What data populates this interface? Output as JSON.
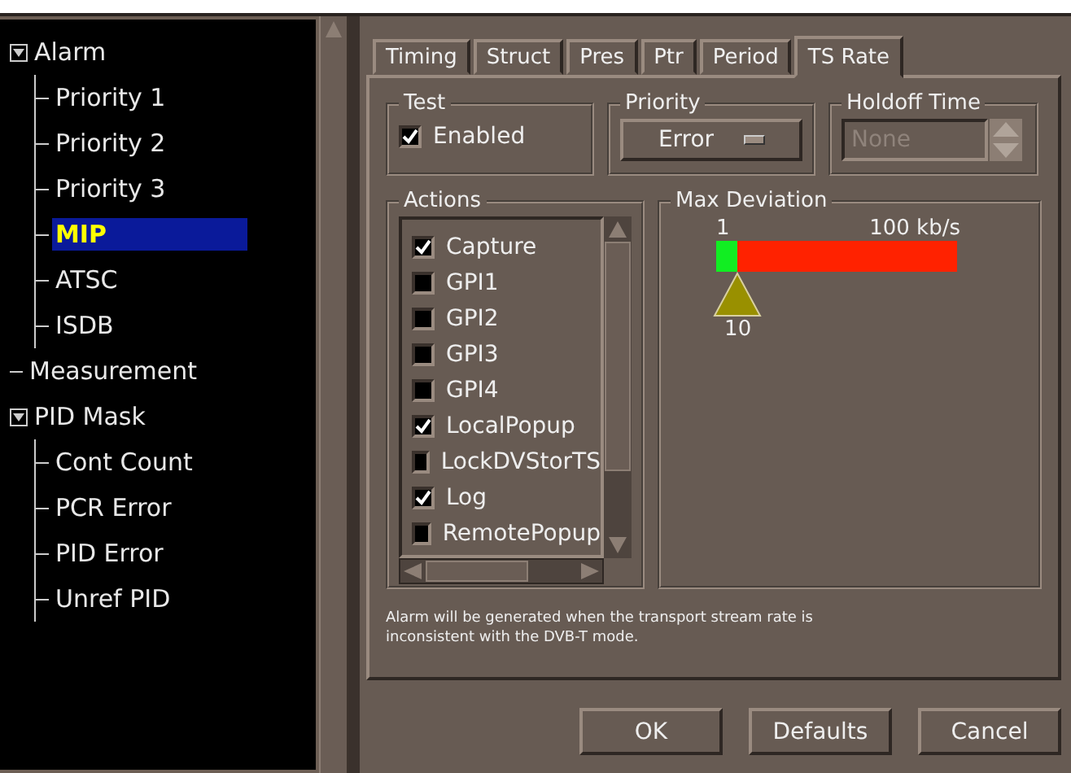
{
  "tree": [
    {
      "label": "Alarm",
      "expanded": true,
      "selected": false,
      "children": [
        {
          "label": "Priority 1",
          "selected": false
        },
        {
          "label": "Priority 2",
          "selected": false
        },
        {
          "label": "Priority 3",
          "selected": false
        },
        {
          "label": "MIP",
          "selected": true
        },
        {
          "label": "ATSC",
          "selected": false
        },
        {
          "label": "ISDB",
          "selected": false
        }
      ]
    },
    {
      "label": "Measurement",
      "selected": false
    },
    {
      "label": "PID Mask",
      "expanded": true,
      "selected": false,
      "children": [
        {
          "label": "Cont Count",
          "selected": false
        },
        {
          "label": "PCR Error",
          "selected": false
        },
        {
          "label": "PID Error",
          "selected": false
        },
        {
          "label": "Unref PID",
          "selected": false
        }
      ]
    }
  ],
  "tabs": [
    {
      "label": "Timing",
      "selected": false
    },
    {
      "label": "Struct",
      "selected": false
    },
    {
      "label": "Pres",
      "selected": false
    },
    {
      "label": "Ptr",
      "selected": false
    },
    {
      "label": "Period",
      "selected": false
    },
    {
      "label": "TS Rate",
      "selected": true
    }
  ],
  "test": {
    "title": "Test",
    "label": "Enabled",
    "checked": true
  },
  "priority": {
    "title": "Priority",
    "value": "Error"
  },
  "holdoff": {
    "title": "Holdoff Time",
    "value": "None",
    "disabled": true
  },
  "actions": {
    "title": "Actions",
    "items": [
      {
        "label": "Capture",
        "checked": true
      },
      {
        "label": "GPI1",
        "checked": false
      },
      {
        "label": "GPI2",
        "checked": false
      },
      {
        "label": "GPI3",
        "checked": false
      },
      {
        "label": "GPI4",
        "checked": false
      },
      {
        "label": "LocalPopup",
        "checked": true
      },
      {
        "label": "LockDVStorTS",
        "checked": false
      },
      {
        "label": "Log",
        "checked": true
      },
      {
        "label": "RemotePopup",
        "checked": false
      }
    ]
  },
  "max_deviation": {
    "title": "Max Deviation",
    "min_label": "1",
    "max_label": "100 kb/s",
    "level": 0.09,
    "reading": "10"
  },
  "note": "Alarm will be generated when the transport stream rate is inconsistent with the DVB-T mode.",
  "buttons": [
    "OK",
    "Defaults",
    "Cancel"
  ]
}
